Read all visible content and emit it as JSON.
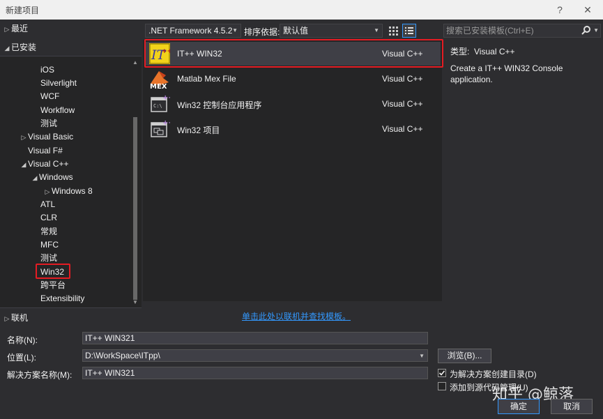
{
  "window": {
    "title": "新建项目",
    "help": "?",
    "close": "✕"
  },
  "tree": {
    "recent": "最近",
    "installed": "已安装",
    "items": [
      "iOS",
      "Silverlight",
      "WCF",
      "Workflow",
      "测试",
      "Visual Basic",
      "Visual F#",
      "Visual C++",
      "Windows",
      "Windows 8",
      "ATL",
      "CLR",
      "常规",
      "MFC",
      "测试",
      "Win32",
      "跨平台",
      "Extensibility"
    ],
    "online": "联机"
  },
  "toolbar": {
    "framework": ".NET Framework 4.5.2",
    "sort_label": "排序依据:",
    "sort_value": "默认值",
    "search_placeholder": "搜索已安装模板(Ctrl+E)"
  },
  "templates": [
    {
      "name": "IT++ WIN32",
      "lang": "Visual C++",
      "icon": "itpp-icon"
    },
    {
      "name": "Matlab Mex File",
      "lang": "Visual C++",
      "icon": "mex-icon"
    },
    {
      "name": "Win32 控制台应用程序",
      "lang": "Visual C++",
      "icon": "console-app-icon"
    },
    {
      "name": "Win32 项目",
      "lang": "Visual C++",
      "icon": "win32-project-icon"
    }
  ],
  "detail": {
    "type_label": "类型:",
    "type_value": "Visual C++",
    "description": "Create a IT++ WIN32 Console application."
  },
  "online_link": "单击此处以联机并查找模板。",
  "form": {
    "name_label": "名称(N):",
    "name_value": "IT++ WIN321",
    "location_label": "位置(L):",
    "location_value": "D:\\WorkSpace\\ITpp\\",
    "solution_label": "解决方案名称(M):",
    "solution_value": "IT++ WIN321",
    "browse": "浏览(B)...",
    "create_dir": "为解决方案创建目录(D)",
    "add_scm": "添加到源代码管理(U)",
    "ok": "确定",
    "cancel": "取消"
  },
  "watermark": "知乎 @鲸落",
  "colors": {
    "accent": "#3399ff",
    "highlight_border": "#e51c23",
    "background": "#2d2d30"
  }
}
